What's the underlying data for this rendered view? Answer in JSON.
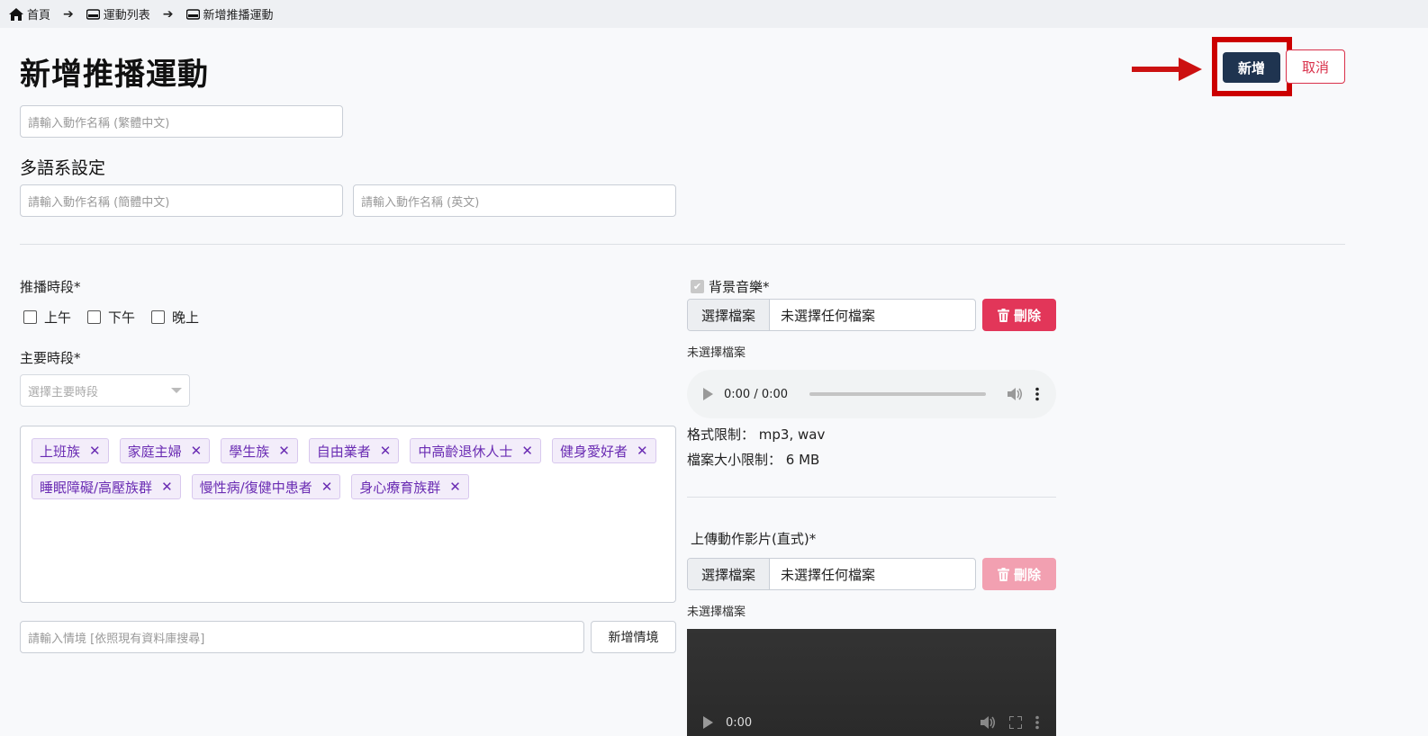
{
  "breadcrumb": {
    "home": "首頁",
    "list": "運動列表",
    "current": "新增推播運動"
  },
  "page": {
    "title": "新增推播運動",
    "add_button": "新增",
    "cancel_button": "取消"
  },
  "name_inputs": {
    "traditional_placeholder": "請輸入動作名稱 (繁體中文)",
    "simplified_placeholder": "請輸入動作名稱 (簡體中文)",
    "english_placeholder": "請輸入動作名稱 (英文)"
  },
  "multilang": {
    "title": "多語系設定"
  },
  "push_time": {
    "label": "推播時段*",
    "options": [
      "上午",
      "下午",
      "晚上"
    ]
  },
  "main_time": {
    "label": "主要時段*",
    "placeholder": "選擇主要時段"
  },
  "tags": [
    "上班族",
    "家庭主婦",
    "學生族",
    "自由業者",
    "中高齡退休人士",
    "健身愛好者",
    "睡眠障礙/高壓族群",
    "慢性病/復健中患者",
    "身心療育族群"
  ],
  "context": {
    "placeholder": "請輸入情境 [依照現有資料庫搜尋]",
    "add_button": "新增情境"
  },
  "bg_music": {
    "label": "背景音樂*",
    "choose_button": "選擇檔案",
    "file_name": "未選擇任何檔案",
    "delete_button": "刪除",
    "status": "未選擇檔案",
    "time": "0:00 / 0:00",
    "format_limit": "格式限制： mp3, wav",
    "size_limit": "檔案大小限制： 6 MB"
  },
  "video": {
    "label": "上傳動作影片(直式)*",
    "choose_button": "選擇檔案",
    "file_name": "未選擇任何檔案",
    "delete_button": "刪除",
    "status": "未選擇檔案",
    "time": "0:00"
  },
  "colors": {
    "primary": "#1f3450",
    "danger": "#e23659",
    "tag_text": "#6a2cb3",
    "highlight": "#cc0000"
  }
}
